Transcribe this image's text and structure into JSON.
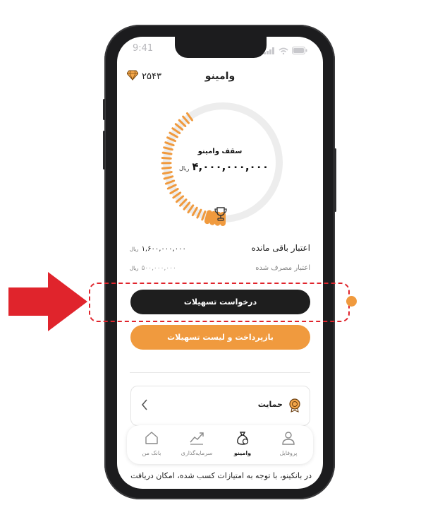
{
  "status_bar": {
    "time": "9:41"
  },
  "header": {
    "title": "وامینو",
    "points": "۲۵۴۳"
  },
  "gauge": {
    "title": "سقف وامینو",
    "amount": "۴,۰۰۰,۰۰۰,۰۰۰",
    "unit": "ریال",
    "progress_fraction": 0.4
  },
  "credit": {
    "remaining_label": "اعتبار باقی مانده",
    "remaining_amount": "۱,۶۰۰,۰۰۰,۰۰۰",
    "remaining_unit": "ریال",
    "used_label": "اعتبار مصرف شده",
    "used_amount": "۵۰۰,۰۰۰,۰۰۰",
    "used_unit": "ریال"
  },
  "buttons": {
    "request_facility": "درخواست تسهیلات",
    "repay_list": "بازپرداخت و لیست تسهیلات"
  },
  "support": {
    "label": "حمایت"
  },
  "bottom_nav": {
    "profile": "پروفایل",
    "vamino": "وامینو",
    "investment": "سرمایه‌گذاری",
    "my_bank": "بانک من"
  },
  "footer_text": "در بانکینو، با توجه به امتیازات کسب شده، امکان دریافت",
  "colors": {
    "accent": "#f09a3e",
    "dark_button": "#1e1e1e",
    "annotation_red": "#e0242c"
  }
}
